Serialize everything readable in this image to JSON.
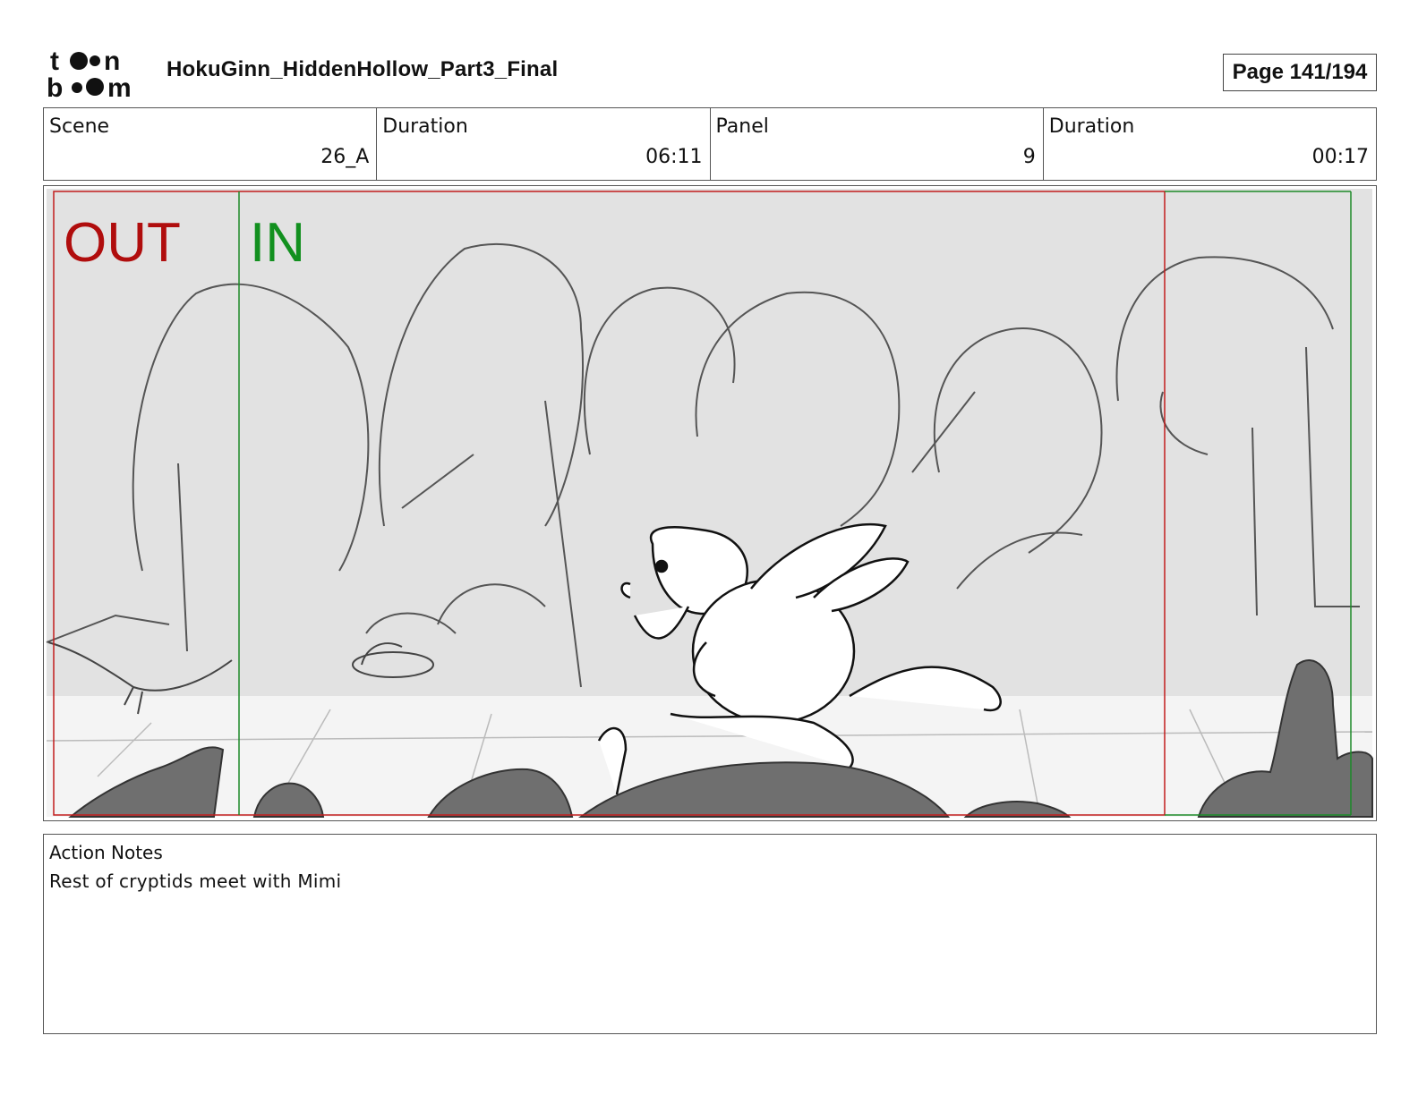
{
  "header": {
    "logo_text": "toonboom",
    "document_title": "HokuGinn_HiddenHollow_Part3_Final",
    "page_label": "Page 141/194"
  },
  "info": {
    "scene_label": "Scene",
    "scene_value": "26_A",
    "scene_duration_label": "Duration",
    "scene_duration_value": "06:11",
    "panel_label": "Panel",
    "panel_value": "9",
    "panel_duration_label": "Duration",
    "panel_duration_value": "00:17"
  },
  "panel_image": {
    "out_label": "OUT",
    "in_label": "IN",
    "out_color": "#b00d0d",
    "in_color": "#12901f",
    "sky_color": "#e2e2e2"
  },
  "notes": {
    "label": "Action Notes",
    "text": "Rest of cryptids meet with Mimi"
  }
}
